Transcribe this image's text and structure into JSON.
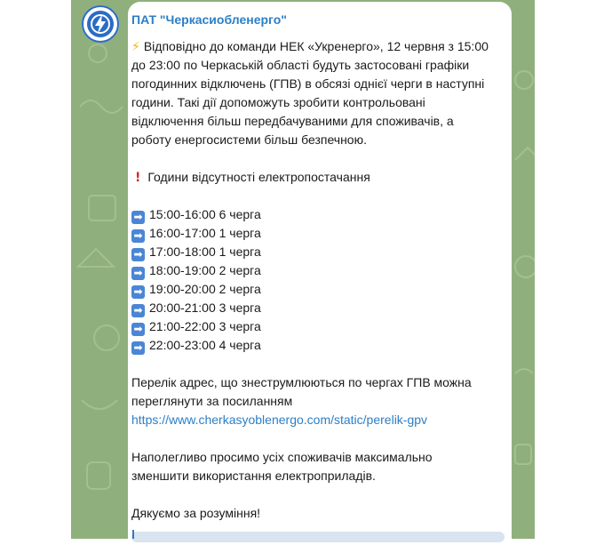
{
  "channel": {
    "sender_name": "ПАТ \"Черкасиобленерго\"",
    "avatar_icon": "lightning-logo-icon"
  },
  "message": {
    "intro_lines": [
      "Відповідно до команди НЕК «Укренерго», 12 червня з 15:00",
      "до 23:00 по Черкаській області будуть застосовані графіки",
      "погодинних відключень (ГПВ) в обсязі однієї черги в наступні",
      "години. Такі дії допоможуть зробити контрольовані",
      "відключення більш передбачуваними для споживачів, а",
      "роботу енергосистеми більш безпечною."
    ],
    "hours_heading": "Години відсутності електропостачання",
    "schedule": [
      "15:00-16:00 6 черга",
      "16:00-17:00 1 черга",
      "17:00-18:00 1 черга",
      "18:00-19:00 2 черга",
      "19:00-20:00 2 черга",
      "20:00-21:00 3 черга",
      "21:00-22:00 3 черга",
      "22:00-23:00 4 черга"
    ],
    "list_lines": [
      "Перелік адрес, що знеструмлюються по чергах ГПВ можна",
      "переглянути за посиланням"
    ],
    "link": "https://www.cherkasyoblenergo.com/static/perelik-gpv",
    "request_lines": [
      "Наполегливо просимо усіх споживачів максимально",
      "зменшити використання електроприладів."
    ],
    "thanks": "Дякуємо за розуміння!"
  },
  "colors": {
    "chat_background": "#8fb07c",
    "sender": "#2b7fc7",
    "link": "#2b7fc7",
    "arrow_emoji": "#4a86d4"
  }
}
